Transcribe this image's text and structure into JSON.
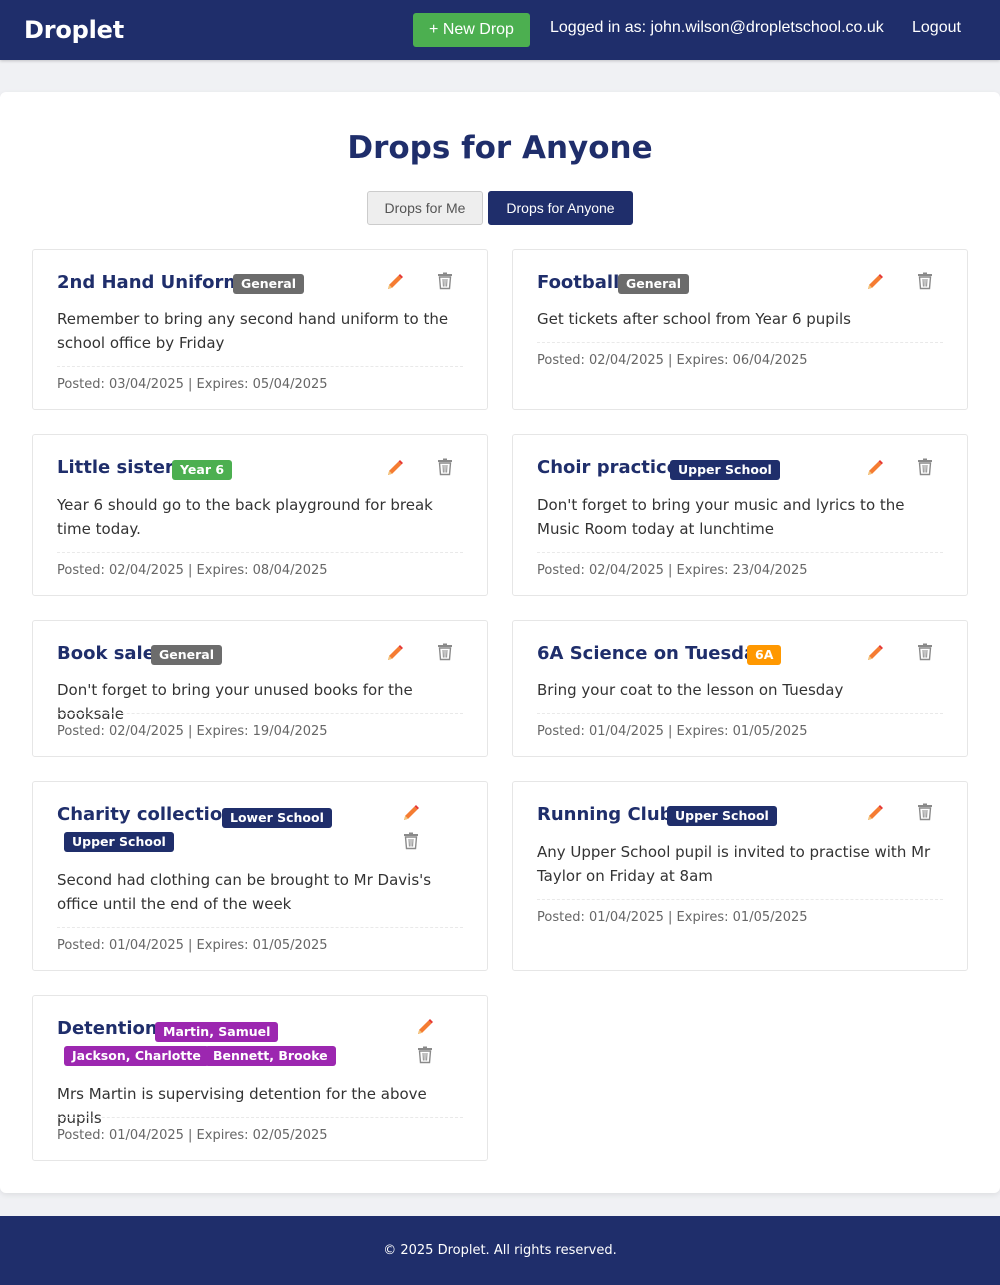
{
  "header": {
    "brand": "Droplet",
    "new_drop_label": "+ New Drop",
    "user_label": "Logged in as: john.wilson@dropletschool.co.uk",
    "logout_label": "Logout"
  },
  "main": {
    "title": "Drops for Anyone",
    "tabs": [
      {
        "label": "Drops for Me",
        "active": false
      },
      {
        "label": "Drops for Anyone",
        "active": true
      }
    ]
  },
  "colors": {
    "brand": "#1f2e6b",
    "new_button": "#4caf50",
    "tag_general": "#6c6c6c",
    "tag_year": "#4caf50",
    "tag_school": "#1f2e6b",
    "tag_class": "#ff9800",
    "tag_pupil": "#9c27b0",
    "edit_icon": "#f57c32",
    "delete_icon": "#8a8a8a"
  },
  "drops": [
    {
      "title": "2nd Hand Uniform",
      "tags": [
        "General"
      ],
      "text": "Remember to bring any second hand uniform to the school office by Friday",
      "meta": "Posted: 03/04/2025 | Expires: 05/04/2025",
      "edit_icon": "pencil-icon",
      "delete_icon": "trash-icon"
    },
    {
      "title": "Football",
      "tags": [
        "General"
      ],
      "text": "Get tickets after school from Year 6 pupils",
      "meta": "Posted: 02/04/2025 | Expires: 06/04/2025",
      "edit_icon": "pencil-icon",
      "delete_icon": "trash-icon"
    },
    {
      "title": "Little sisters",
      "tags": [
        "Year 6"
      ],
      "text": "Year 6 should go to the back playground for break time today.",
      "meta": "Posted: 02/04/2025 | Expires: 08/04/2025",
      "edit_icon": "pencil-icon",
      "delete_icon": "trash-icon"
    },
    {
      "title": "Choir practice",
      "tags": [
        "Upper School"
      ],
      "text": "Don't forget to bring your music and lyrics to the Music Room today at lunchtime",
      "meta": "Posted: 02/04/2025 | Expires: 23/04/2025",
      "edit_icon": "pencil-icon",
      "delete_icon": "trash-icon"
    },
    {
      "title": "Book sale",
      "tags": [
        "General"
      ],
      "text": "Don't forget to bring your unused books for the booksale",
      "meta": "Posted: 02/04/2025 | Expires: 19/04/2025",
      "edit_icon": "pencil-icon",
      "delete_icon": "trash-icon"
    },
    {
      "title": "6A Science on Tuesday",
      "tags": [
        "6A"
      ],
      "text": "Bring your coat to the lesson on Tuesday",
      "meta": "Posted: 01/04/2025 | Expires: 01/05/2025",
      "edit_icon": "pencil-icon",
      "delete_icon": "trash-icon"
    },
    {
      "title": "Charity collection",
      "tags": [
        "Lower School",
        "Upper School"
      ],
      "text": "Second had clothing can be brought to Mr Davis's office until the end of the week",
      "meta": "Posted: 01/04/2025 | Expires: 01/05/2025",
      "edit_icon": "pencil-icon",
      "delete_icon": "trash-icon"
    },
    {
      "title": "Running Club",
      "tags": [
        "Upper School"
      ],
      "text": "Any Upper School pupil is invited to practise with Mr Taylor on Friday at 8am",
      "meta": "Posted: 01/04/2025 | Expires: 01/05/2025",
      "edit_icon": "pencil-icon",
      "delete_icon": "trash-icon"
    },
    {
      "title": "Detention",
      "tags": [
        "Martin, Samuel",
        "Jackson, Charlotte",
        "Bennett, Brooke"
      ],
      "text": "Mrs Martin is supervising detention for the above pupils",
      "meta": "Posted: 01/04/2025 | Expires: 02/05/2025",
      "edit_icon": "pencil-icon",
      "delete_icon": "trash-icon"
    }
  ],
  "footer": {
    "text": "© 2025 Droplet. All rights reserved."
  }
}
